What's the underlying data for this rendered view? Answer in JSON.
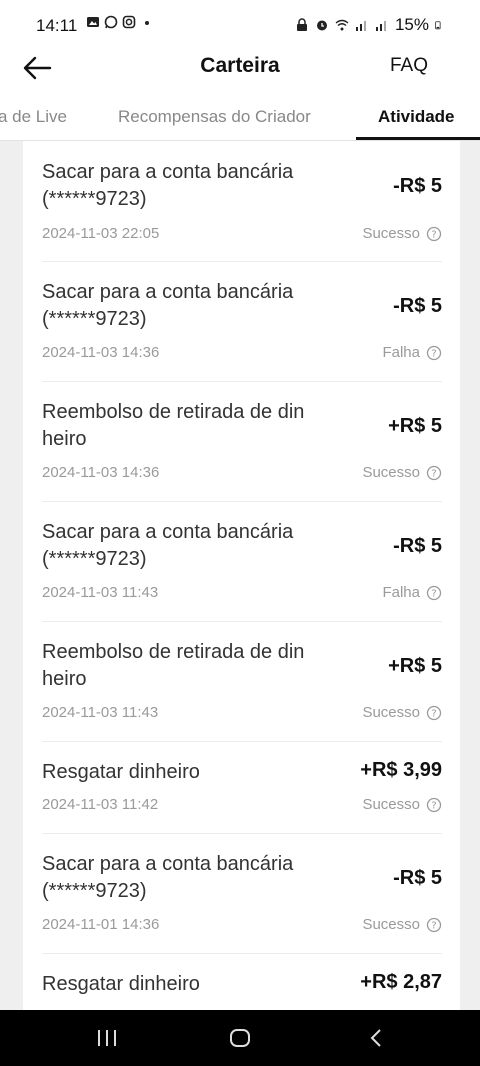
{
  "status_bar": {
    "time": "14:11",
    "battery": "15%"
  },
  "header": {
    "title": "Carteira",
    "faq": "FAQ"
  },
  "tabs": [
    {
      "label": "a de Live"
    },
    {
      "label": "Recompensas do Criador"
    },
    {
      "label": "Atividade"
    }
  ],
  "transactions": [
    {
      "desc_line1": "Sacar para a conta bancária",
      "desc_line2": "(******9723)",
      "amount": "-R$ 5",
      "date": "2024-11-03 22:05",
      "status": "Sucesso"
    },
    {
      "desc_line1": "Sacar para a conta bancária",
      "desc_line2": "(******9723)",
      "amount": "-R$ 5",
      "date": "2024-11-03 14:36",
      "status": "Falha"
    },
    {
      "desc_line1": "Reembolso de retirada de din",
      "desc_line2": "heiro",
      "amount": "+R$ 5",
      "date": "2024-11-03 14:36",
      "status": "Sucesso"
    },
    {
      "desc_line1": "Sacar para a conta bancária",
      "desc_line2": "(******9723)",
      "amount": "-R$ 5",
      "date": "2024-11-03 11:43",
      "status": "Falha"
    },
    {
      "desc_line1": "Reembolso de retirada de din",
      "desc_line2": "heiro",
      "amount": "+R$ 5",
      "date": "2024-11-03 11:43",
      "status": "Sucesso"
    },
    {
      "desc_line1": "Resgatar dinheiro",
      "desc_line2": "",
      "amount": "+R$ 3,99",
      "date": "2024-11-03 11:42",
      "status": "Sucesso"
    },
    {
      "desc_line1": "Sacar para a conta bancária",
      "desc_line2": "(******9723)",
      "amount": "-R$ 5",
      "date": "2024-11-01 14:36",
      "status": "Sucesso"
    },
    {
      "desc_line1": "Resgatar dinheiro",
      "desc_line2": "",
      "amount": "+R$ 2,87",
      "date": "",
      "status": ""
    }
  ]
}
